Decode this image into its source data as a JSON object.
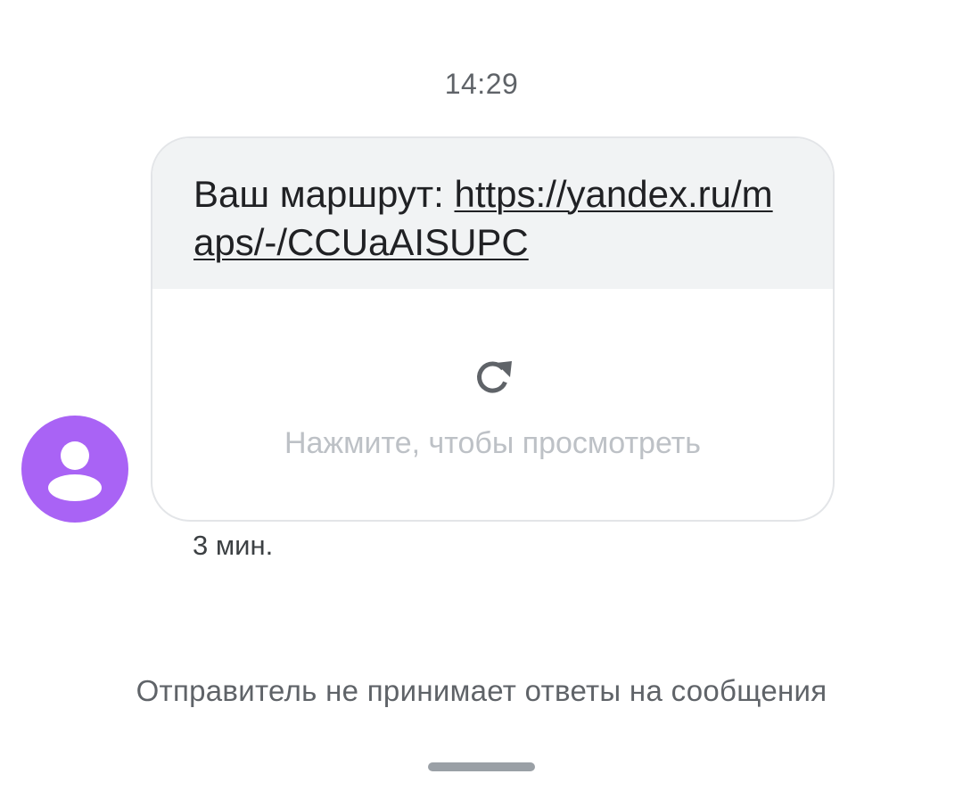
{
  "conversation": {
    "timestamp": "14:29",
    "message": {
      "text_prefix": "Ваш маршрут: ",
      "link": "https://yandex.ru/maps/-/CCUaAISUPC",
      "preview": {
        "icon": "refresh-icon",
        "label": "Нажмите, чтобы просмотреть"
      },
      "age": "3 мин."
    },
    "sender": {
      "avatar_icon": "person-icon",
      "avatar_color": "#a963f5"
    },
    "footer_notice": "Отправитель не принимает ответы на сообщения"
  }
}
